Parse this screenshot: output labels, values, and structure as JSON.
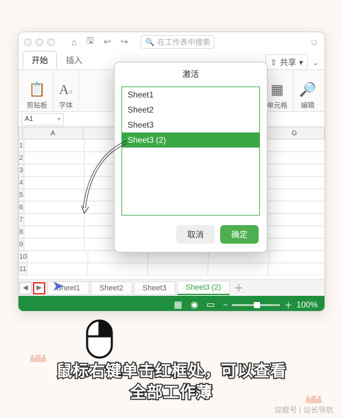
{
  "window": {
    "search_placeholder": "在工作表中搜索",
    "share_label": "共享"
  },
  "tabs": {
    "start": "开始",
    "insert": "插入"
  },
  "ribbon_groups": {
    "clipboard": "剪贴板",
    "font": "字体",
    "cells": "单元格",
    "edit": "编辑"
  },
  "namebox_value": "A1",
  "columns": [
    "A",
    "",
    "",
    "",
    "G"
  ],
  "rows": [
    "1",
    "2",
    "3",
    "4",
    "5",
    "6",
    "7",
    "8",
    "9",
    "10",
    "11"
  ],
  "sheet_tabs": [
    "Sheet1",
    "Sheet2",
    "Sheet3",
    "Sheet3 (2)"
  ],
  "active_sheet_index": 3,
  "statusbar": {
    "zoom": "100%"
  },
  "dialog": {
    "title": "激活",
    "items": [
      "Sheet1",
      "Sheet2",
      "Sheet3",
      "Sheet3 (2)"
    ],
    "selected_index": 3,
    "cancel": "取消",
    "ok": "确定"
  },
  "caption_line1": "鼠标右键单击红框处，可以查看",
  "caption_line2": "全部工作薄",
  "watermark": "双截号 | 站长导航",
  "quote_glyph": "❝❝"
}
